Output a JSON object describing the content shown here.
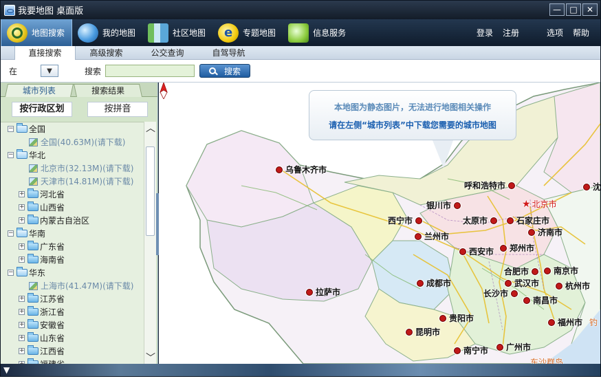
{
  "window": {
    "title": "我要地图 桌面版",
    "controls": [
      "—",
      "□",
      "✕"
    ]
  },
  "toolbar": {
    "items": [
      {
        "label": "地图搜索",
        "icon": "search-map-icon",
        "active": true
      },
      {
        "label": "我的地图",
        "icon": "people-icon",
        "active": false
      },
      {
        "label": "社区地图",
        "icon": "building-icon",
        "active": false
      },
      {
        "label": "专题地图",
        "icon": "theme-e-icon",
        "active": false
      },
      {
        "label": "信息服务",
        "icon": "info-service-icon",
        "active": false
      }
    ],
    "right": {
      "login": "登录",
      "register": "注册",
      "options": "选项",
      "help": "帮助"
    }
  },
  "subtabs": [
    "直接搜索",
    "高级搜索",
    "公交查询",
    "自驾导航"
  ],
  "search": {
    "in_label": "在",
    "select_value": "",
    "search_label": "搜索",
    "input_value": "",
    "button_label": "搜索"
  },
  "left_panel": {
    "tabs": [
      "城市列表",
      "搜索结果"
    ],
    "mode_buttons": [
      "按行政区划",
      "按拼音"
    ],
    "tree": [
      {
        "type": "group",
        "label": "全国"
      },
      {
        "type": "leaf",
        "label": "全国(40.63M)(请下载)"
      },
      {
        "type": "group",
        "label": "华北"
      },
      {
        "type": "leaf",
        "label": "北京市(32.13M)(请下载)"
      },
      {
        "type": "leaf",
        "label": "天津市(14.81M)(请下载)"
      },
      {
        "type": "folder",
        "label": "河北省"
      },
      {
        "type": "folder",
        "label": "山西省"
      },
      {
        "type": "folder",
        "label": "内蒙古自治区"
      },
      {
        "type": "group",
        "label": "华南"
      },
      {
        "type": "folder",
        "label": "广东省"
      },
      {
        "type": "folder",
        "label": "海南省"
      },
      {
        "type": "group",
        "label": "华东"
      },
      {
        "type": "leaf",
        "label": "上海市(41.47M)(请下载)"
      },
      {
        "type": "folder",
        "label": "江苏省"
      },
      {
        "type": "folder",
        "label": "浙江省"
      },
      {
        "type": "folder",
        "label": "安徽省"
      },
      {
        "type": "folder",
        "label": "山东省"
      },
      {
        "type": "folder",
        "label": "江西省"
      },
      {
        "type": "folder",
        "label": "福建省"
      }
    ]
  },
  "map": {
    "notice_line1": "本地图为静态图片，无法进行地图相关操作",
    "notice_line2": "请在左侧“城市列表”中下载您需要的城市地图",
    "capital": "北京市",
    "cities": [
      "乌鲁木齐市",
      "呼和浩特市",
      "银川市",
      "西宁市",
      "兰州市",
      "太原市",
      "石家庄市",
      "济南市",
      "西安市",
      "郑州市",
      "合肥市",
      "南京市",
      "武汉市",
      "杭州市",
      "成都市",
      "拉萨市",
      "长沙市",
      "南昌市",
      "贵阳市",
      "昆明市",
      "福州市",
      "南宁市",
      "广州市",
      "沈"
    ],
    "partial_labels": [
      "东沙群岛",
      "钓"
    ],
    "colors": {
      "capital": "#d21a1a",
      "city_dot": "#c01919",
      "notice_blue": "#1a5fb0"
    }
  }
}
